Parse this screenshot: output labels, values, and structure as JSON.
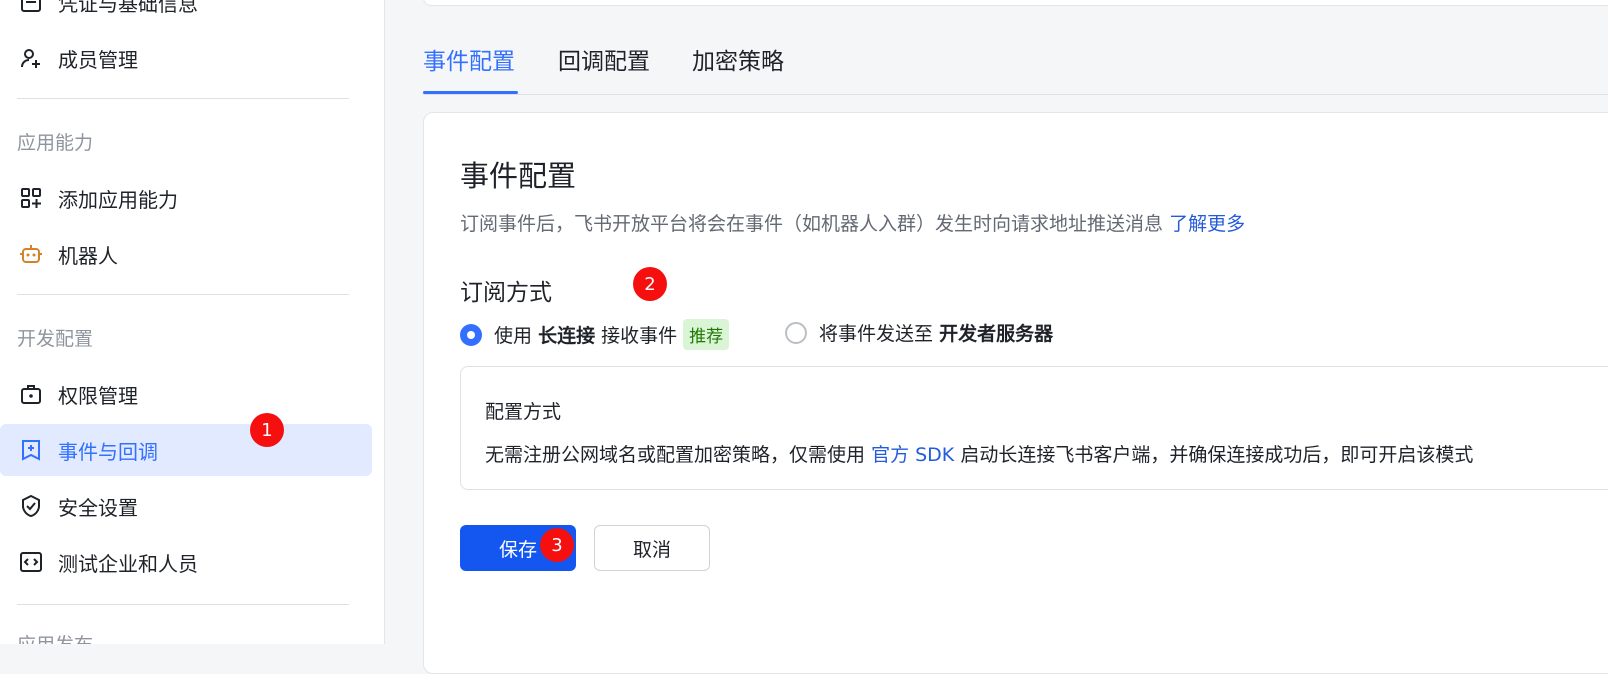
{
  "sidebar": {
    "items": [
      {
        "label": "凭证与基础信息",
        "icon": "id-card-icon"
      },
      {
        "label": "成员管理",
        "icon": "user-add-icon"
      },
      {
        "label": "添加应用能力",
        "icon": "grid-add-icon"
      },
      {
        "label": "机器人",
        "icon": "robot-icon"
      },
      {
        "label": "权限管理",
        "icon": "briefcase-icon"
      },
      {
        "label": "事件与回调",
        "icon": "event-callback-icon"
      },
      {
        "label": "安全设置",
        "icon": "shield-icon"
      },
      {
        "label": "测试企业和人员",
        "icon": "code-icon"
      }
    ],
    "sections": [
      "应用能力",
      "开发配置",
      "应用发布"
    ],
    "active_item": "事件与回调"
  },
  "annotations": [
    "1",
    "2",
    "3"
  ],
  "tabs": [
    {
      "label": "事件配置",
      "active": true
    },
    {
      "label": "回调配置",
      "active": false
    },
    {
      "label": "加密策略",
      "active": false
    }
  ],
  "card": {
    "title": "事件配置",
    "description": "订阅事件后，飞书开放平台将会在事件（如机器人入群）发生时向请求地址推送消息",
    "learn_more": "了解更多",
    "subscribe_title": "订阅方式",
    "option1": {
      "prefix": "使用",
      "bold": "长连接",
      "suffix": "接收事件",
      "tag": "推荐",
      "selected": true
    },
    "option2": {
      "prefix": "将事件发送至",
      "bold": "开发者服务器",
      "selected": false
    },
    "config_title": "配置方式",
    "config_text_before": "无需注册公网域名或配置加密策略，仅需使用",
    "config_link": "官方 SDK",
    "config_text_after": "启动长连接飞书客户端，并确保连接成功后，即可开启该模式",
    "save_label": "保存",
    "cancel_label": "取消"
  },
  "colors": {
    "accent": "#3370ff",
    "primary_button": "#1456f0",
    "badge": "#f50f0f",
    "tag_bg": "#d9f5d6"
  }
}
